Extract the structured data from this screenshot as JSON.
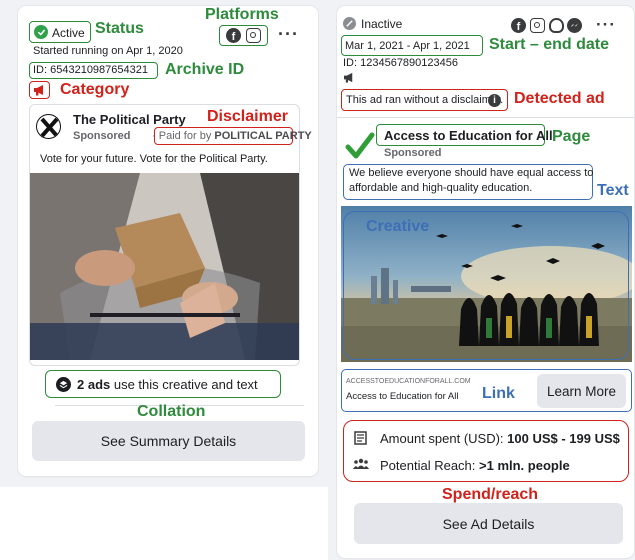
{
  "left_ad": {
    "status": "Active",
    "started": "Started running on Apr 1, 2020",
    "archive_id": "ID: 6543210987654321",
    "page_name": "The Political Party",
    "sponsored": "Sponsored",
    "paid_for_prefix": "Paid for by ",
    "paid_for_name": "POLITICAL PARTY",
    "body_text": "Vote for your future. Vote for the Political Party.",
    "collation_count": "2 ads",
    "collation_text": " use this creative and text",
    "summary_button": "See Summary Details"
  },
  "right_ad": {
    "status": "Inactive",
    "date_range": "Mar 1, 2021 - Apr 1, 2021",
    "archive_id": "ID: 1234567890123456",
    "disclaimer_notice": "This ad ran without a disclaimer.",
    "page_name": "Access to Education for All",
    "sponsored": "Sponsored",
    "body_text_line1": "We believe everyone should have equal access to",
    "body_text_line2": "affordable and high-quality education.",
    "link_domain": "ACCESSTOEDUCATIONFORALL.COM",
    "link_title": "Access to Education for All",
    "cta_button": "Learn More",
    "amount_label": "Amount spent (USD): ",
    "amount_value": "100 US$ - 199 US$",
    "reach_label": "Potential Reach: ",
    "reach_value": ">1 mln. people",
    "details_button": "See Ad Details"
  },
  "annotations": {
    "status": "Status",
    "platforms": "Platforms",
    "archive_id": "Archive ID",
    "category": "Category",
    "disclaimer": "Disclaimer",
    "collation": "Collation",
    "start_end_date": "Start – end date",
    "detected_ad": "Detected ad",
    "page": "Page",
    "text": "Text",
    "creative": "Creative",
    "link": "Link",
    "spend_reach": "Spend/reach"
  },
  "colors": {
    "annotation_green": "#2e8b3c",
    "annotation_red": "#d0221a",
    "annotation_blue": "#3d6fb6",
    "button_gray": "#e4e6eb",
    "active_green": "#31a24c"
  },
  "icons": {
    "status_active": "check-circle-icon",
    "status_inactive": "slash-circle-icon",
    "platforms": [
      "facebook-icon",
      "instagram-icon",
      "audience-network-icon",
      "messenger-icon"
    ],
    "more": "more-dots-icon",
    "category": "megaphone-icon",
    "info": "info-icon",
    "collation": "layers-icon",
    "amount": "receipt-icon",
    "reach": "people-icon"
  }
}
